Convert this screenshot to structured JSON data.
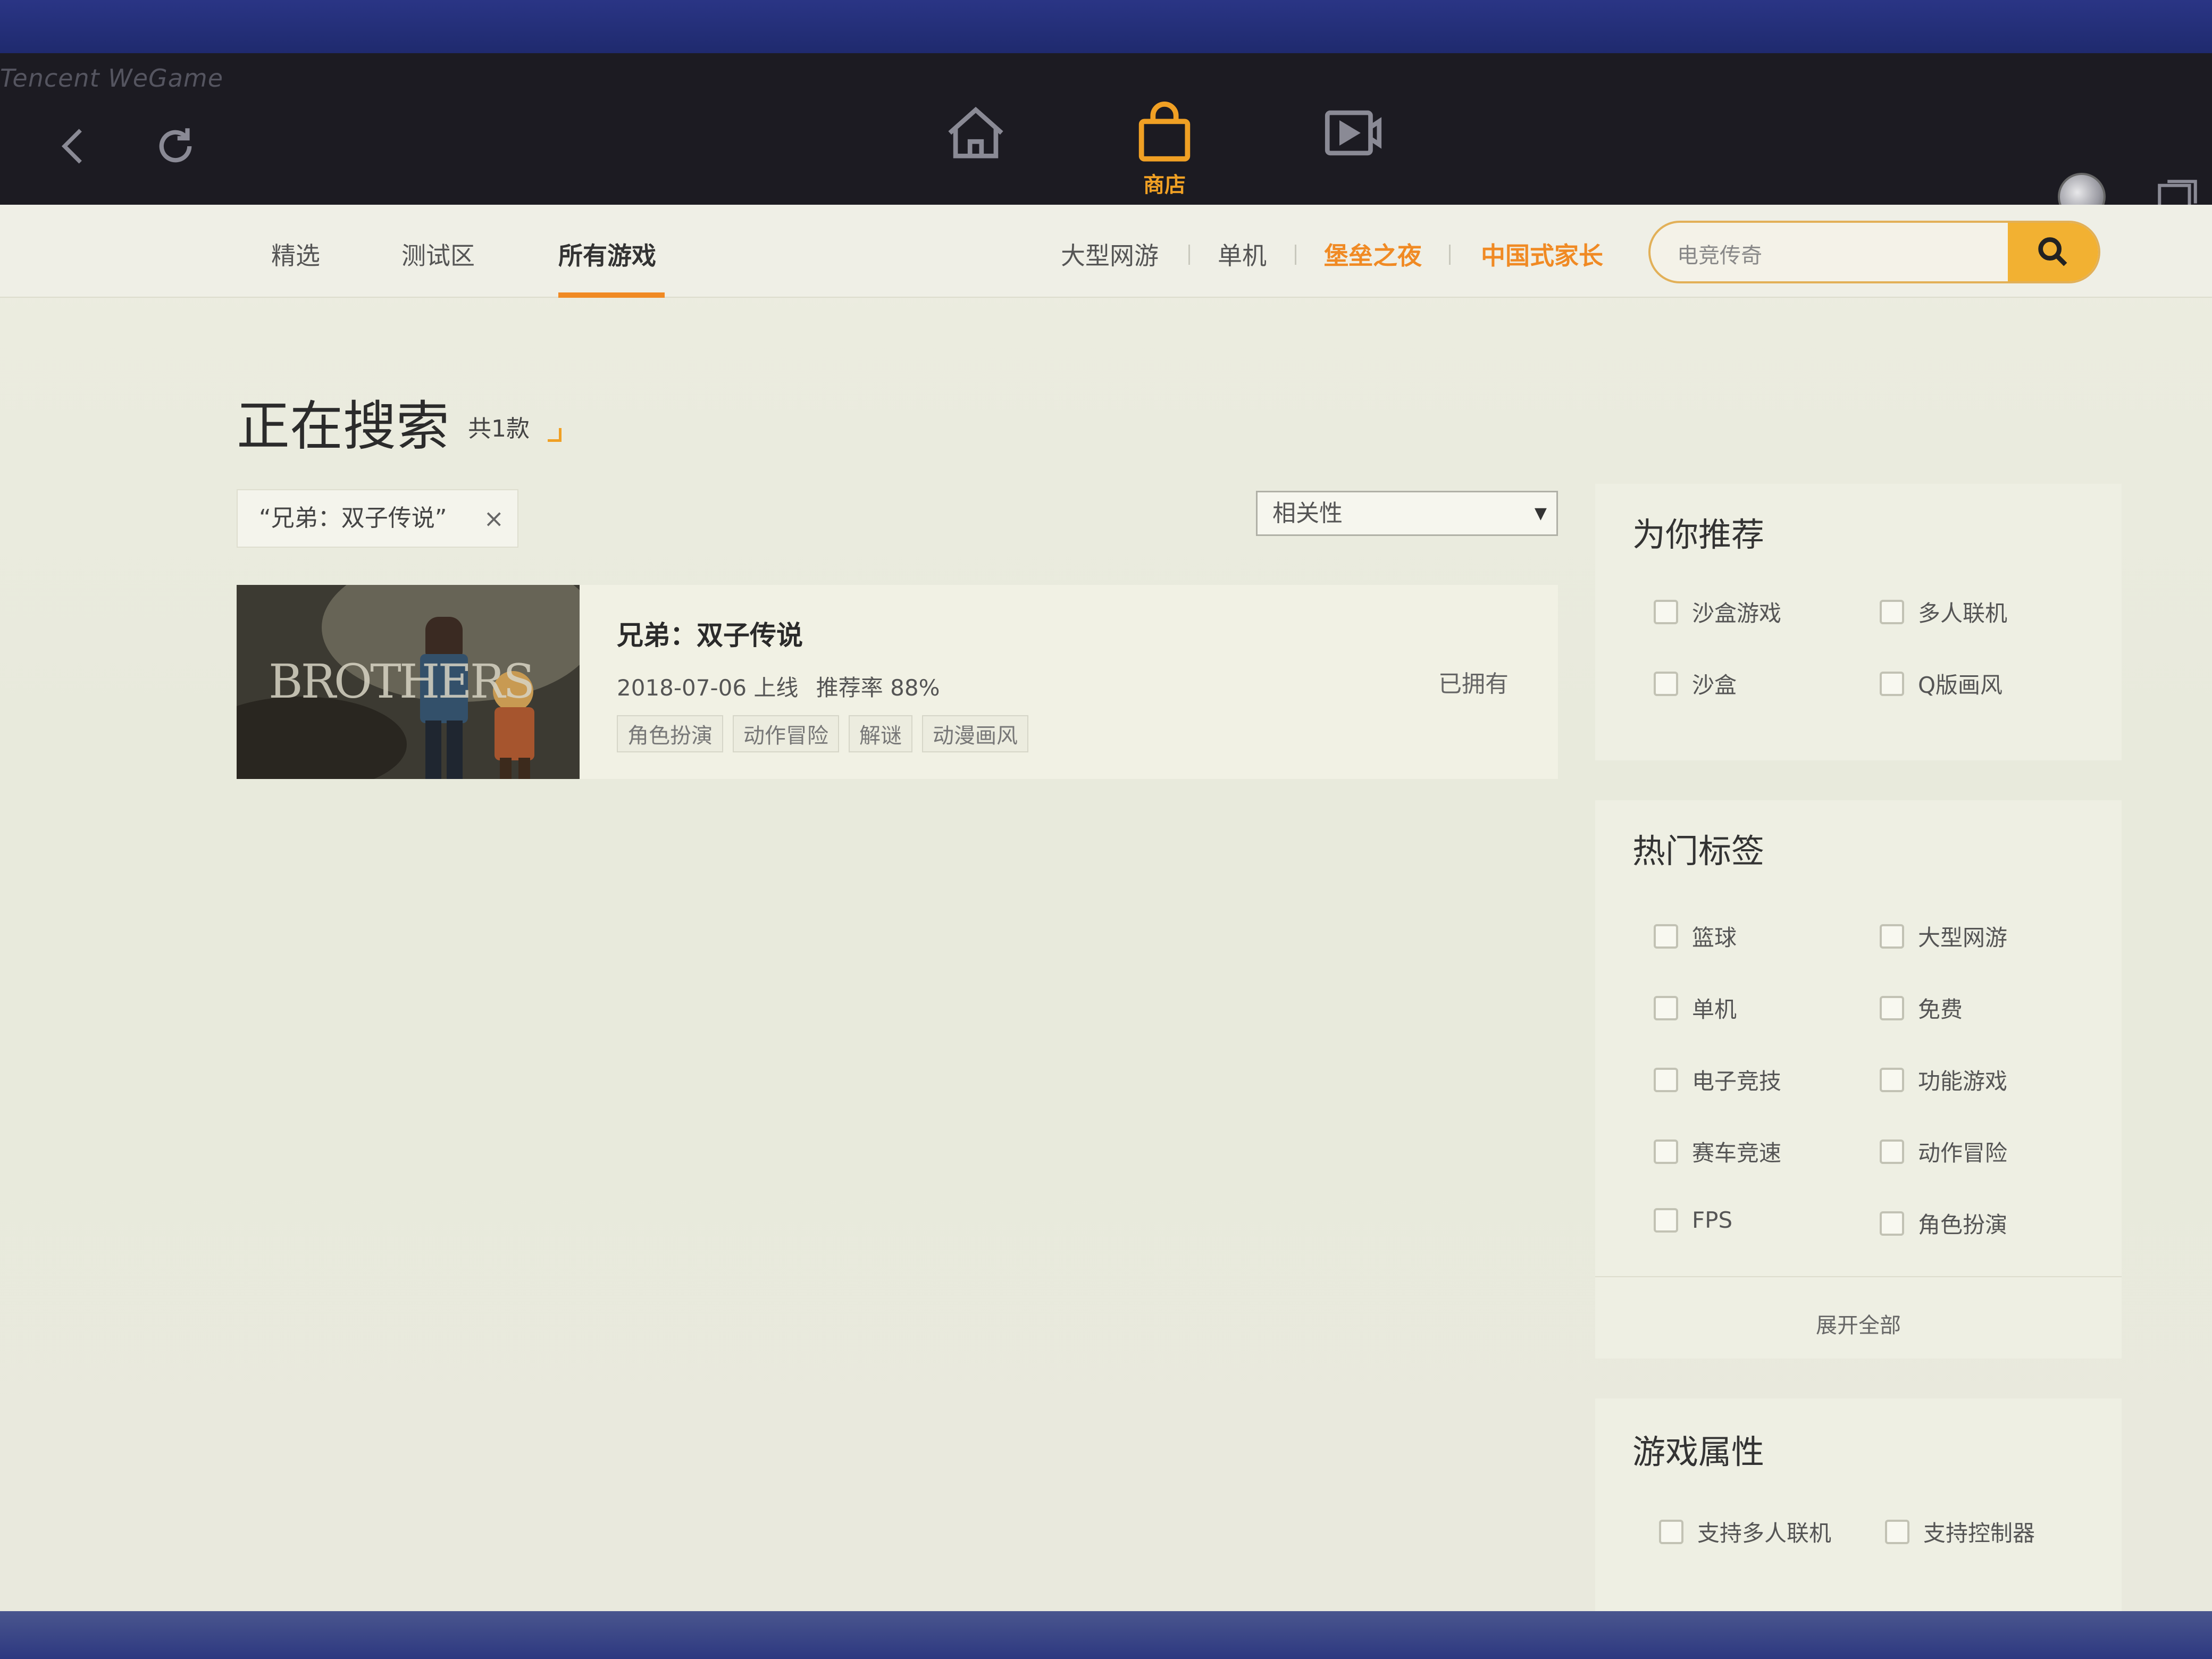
{
  "app": {
    "brand": "Tencent WeGame"
  },
  "topnav": {
    "back_icon": "back-arrow-icon",
    "refresh_icon": "refresh-icon",
    "home_icon": "home-icon",
    "store_icon": "shopping-bag-icon",
    "store_label": "商店",
    "video_icon": "video-icon",
    "avatar_icon": "avatar",
    "chat_icon": "chat-icon",
    "accent_color": "#f0a024"
  },
  "subnav": {
    "tabs": [
      {
        "label": "精选"
      },
      {
        "label": "测试区"
      },
      {
        "label": "所有游戏"
      }
    ],
    "quick_links": [
      {
        "label": "大型网游"
      },
      {
        "label": "单机"
      },
      {
        "label": "堡垒之夜"
      },
      {
        "label": "中国式家长"
      }
    ],
    "search": {
      "value": "电竞传奇",
      "icon": "search-icon"
    }
  },
  "main": {
    "heading": "正在搜索",
    "count": "共1款",
    "filter_chip": "“兄弟：双子传说”",
    "chip_close": "×",
    "sort": {
      "selected": "相关性",
      "arrow": "▼"
    },
    "results": [
      {
        "thumb_text": "BROTHERS",
        "title": "兄弟：双子传说",
        "release": "2018-07-06 上线",
        "rating": "推荐率 88%",
        "tags": [
          "角色扮演",
          "动作冒险",
          "解谜",
          "动漫画风"
        ],
        "status": "已拥有"
      }
    ]
  },
  "sidebar": {
    "recommend": {
      "title": "为你推荐",
      "items": [
        "沙盒游戏",
        "多人联机",
        "沙盒",
        "Q版画风"
      ]
    },
    "hot_tags": {
      "title": "热门标签",
      "items": [
        "篮球",
        "大型网游",
        "单机",
        "免费",
        "电子竞技",
        "功能游戏",
        "赛车竞速",
        "动作冒险",
        "FPS",
        "角色扮演"
      ],
      "expand": "展开全部"
    },
    "attributes": {
      "title": "游戏属性",
      "items": [
        "支持多人联机",
        "支持控制器"
      ]
    }
  }
}
